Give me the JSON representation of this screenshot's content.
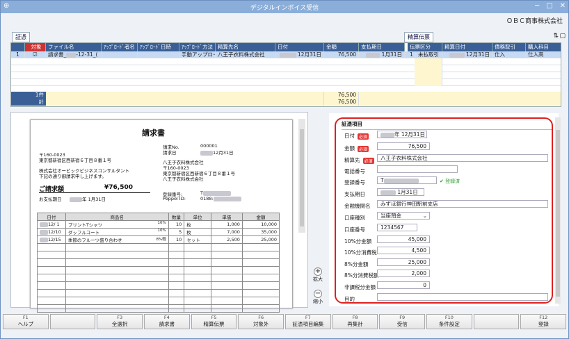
{
  "window": {
    "title": "デジタルインボイス受信",
    "app_icon": "document-plus-icon"
  },
  "company": "ＯＢＣ商事株式会社",
  "tags": {
    "evidence": "証憑",
    "journal": "精算伝票"
  },
  "grid": {
    "headers": [
      "対象",
      "ファイル名",
      "ｱｯﾌﾟﾛｰﾄﾞ者名",
      "ｱｯﾌﾟﾛｰﾄﾞ日時",
      "ｱｯﾌﾟﾛｰﾄﾞ方法",
      "精算先名",
      "日付",
      "金額",
      "支払期日",
      "伝票区分",
      "精算日付",
      "債務取引",
      "購入科目"
    ],
    "row": {
      "no": "1",
      "file": "請求書_",
      "file_suffix": "-12-31_(",
      "method": "手動アップロード",
      "partner": "八王子衣料株式会社",
      "date": "12月31日",
      "amount": "76,500",
      "due": "1月31日",
      "slip_type": "1",
      "slip_name": "未払取引",
      "settle_date": "12月31日",
      "debt": "仕入",
      "account": "仕入高"
    },
    "summary_count": "1件",
    "summary_amount": "76,500",
    "total_label": "計",
    "total_amount": "76,500"
  },
  "invoice": {
    "title": "請求書",
    "no_label": "請求No.",
    "no_value": "000001",
    "date_label": "請求日",
    "date_value": "12月31日",
    "to_zip": "〒160-0023",
    "to_addr": "東京都新宿区西新宿６丁目８番１号",
    "to_name": "株式会社オービックビジネスコンサルタント",
    "to_note": "下記の通り御請求申し上げます。",
    "from_company": "八王子衣料株式会社",
    "from_zip": "〒160-0023",
    "from_addr": "東京都新宿区西新宿６丁目８番１号",
    "reg_label": "登録番号:",
    "reg_value": "T",
    "peppol_label": "Peppol ID:",
    "peppol_value": "0188:",
    "amount_label": "ご請求額",
    "amount_value": "¥76,500",
    "due_label": "お支払期日",
    "due_value": "年 1月31日",
    "cols": [
      "日付",
      "商品名",
      "数量",
      "単位",
      "単価",
      "金額"
    ],
    "items": [
      {
        "date": "12/ 1",
        "name": "プリントTシャツ",
        "tax": "10%",
        "qty": "10",
        "unit": "枚",
        "price": "1,000",
        "amount": "10,000"
      },
      {
        "date": "12/10",
        "name": "ダッフルコート",
        "tax": "10%",
        "qty": "5",
        "unit": "枚",
        "price": "7,000",
        "amount": "35,000"
      },
      {
        "date": "12/15",
        "name": "季節のフルーツ盛り合わせ",
        "tax": "8%軽",
        "qty": "10",
        "unit": "セット",
        "price": "2,500",
        "amount": "25,000"
      }
    ]
  },
  "zoom": {
    "in": "拡大",
    "out": "縮小"
  },
  "form": {
    "title": "証憑項目",
    "required": "必須",
    "date_label": "日付",
    "date_value": "年 12月31日",
    "amount_label": "金額",
    "amount_value": "76,500",
    "partner_label": "精算先",
    "partner_value": "八王子衣料株式会社",
    "phone_label": "電話番号",
    "phone_value": "",
    "reg_label": "登録番号",
    "reg_value": "T",
    "reg_status": "登録済",
    "due_label": "支払期日",
    "due_value": "1月31日",
    "bank_label": "金融機関名",
    "bank_value": "みずほ銀行神田駅前支店",
    "acct_type_label": "口座種別",
    "acct_type_value": "当座預金",
    "acct_no_label": "口座番号",
    "acct_no_value": "1234567",
    "r10_label": "10%分金額",
    "r10_value": "45,000",
    "t10_label": "10%分消費税",
    "t10_value": "4,500",
    "r8_label": "8%分金額",
    "r8_value": "25,000",
    "t8_label": "8%分消費税額",
    "t8_value": "2,000",
    "nontax_label": "非課税分金額",
    "nontax_value": "0",
    "purpose_label": "目的",
    "purpose_value": ""
  },
  "fkeys": [
    {
      "n": "F1",
      "l": "ヘルプ"
    },
    {
      "n": "",
      "l": ""
    },
    {
      "n": "F3",
      "l": "全選択"
    },
    {
      "n": "F4",
      "l": "請求書"
    },
    {
      "n": "F5",
      "l": "精算伝票"
    },
    {
      "n": "F6",
      "l": "対象外"
    },
    {
      "n": "F7",
      "l": "証憑項目編集"
    },
    {
      "n": "F8",
      "l": "再集計"
    },
    {
      "n": "F9",
      "l": "受信"
    },
    {
      "n": "F10",
      "l": "条件設定"
    },
    {
      "n": "",
      "l": ""
    },
    {
      "n": "F12",
      "l": "登録"
    }
  ]
}
